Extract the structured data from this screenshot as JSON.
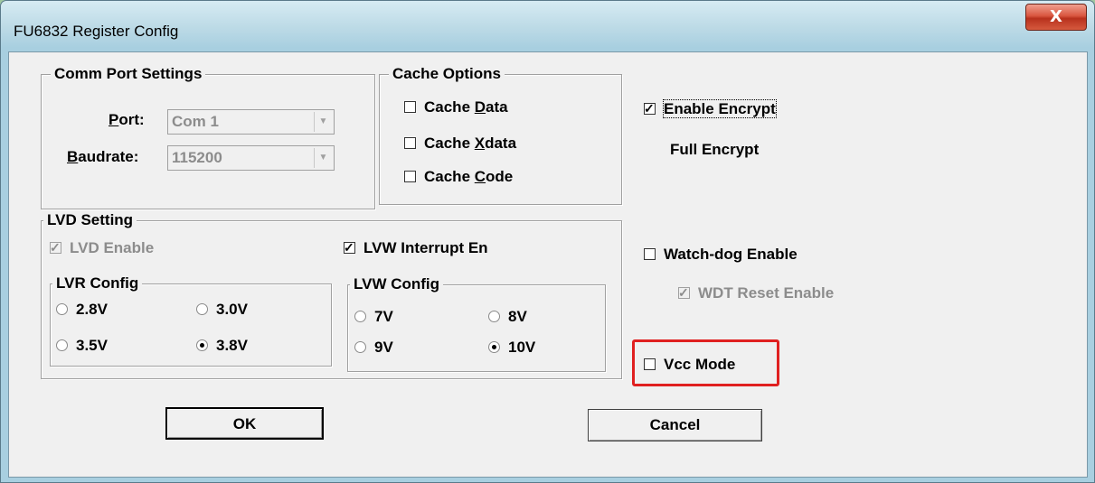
{
  "window": {
    "title": "FU6832 Register Config",
    "close_glyph": "X"
  },
  "comm": {
    "title": "Comm Port Settings",
    "port_label": {
      "u": "P",
      "rest": "ort:"
    },
    "port_value": "Com 1",
    "baud_label": {
      "u": "B",
      "rest": "audrate:"
    },
    "baud_value": "115200"
  },
  "cache": {
    "title": "Cache Options",
    "data": {
      "pre": "Cache ",
      "u": "D",
      "post": "ata",
      "checked": false
    },
    "xdata": {
      "pre": "Cache ",
      "u": "X",
      "post": "data",
      "checked": false
    },
    "code": {
      "pre": "Cache ",
      "u": "C",
      "post": "ode",
      "checked": false
    }
  },
  "encrypt": {
    "label": "Enable Encrypt",
    "checked": true,
    "mode": "Full Encrypt"
  },
  "lvd": {
    "title": "LVD Setting",
    "lvd_enable": "LVD Enable",
    "lvw_interrupt": "LVW Interrupt En",
    "lvr": {
      "title": "LVR Config",
      "opt_28": "2.8V",
      "opt_30": "3.0V",
      "opt_35": "3.5V",
      "opt_38": "3.8V",
      "selected": "3.8V"
    },
    "lvw": {
      "title": "LVW Config",
      "opt_7": "7V",
      "opt_8": "8V",
      "opt_9": "9V",
      "opt_10": "10V",
      "selected": "10V"
    }
  },
  "watchdog": {
    "label": "Watch-dog Enable",
    "checked": false,
    "wdt_reset": "WDT Reset Enable"
  },
  "vcc": {
    "label": "Vcc Mode",
    "checked": false
  },
  "buttons": {
    "ok": "OK",
    "cancel": "Cancel"
  },
  "colors": {
    "highlight": "#e02020",
    "close": "#c8402a"
  }
}
